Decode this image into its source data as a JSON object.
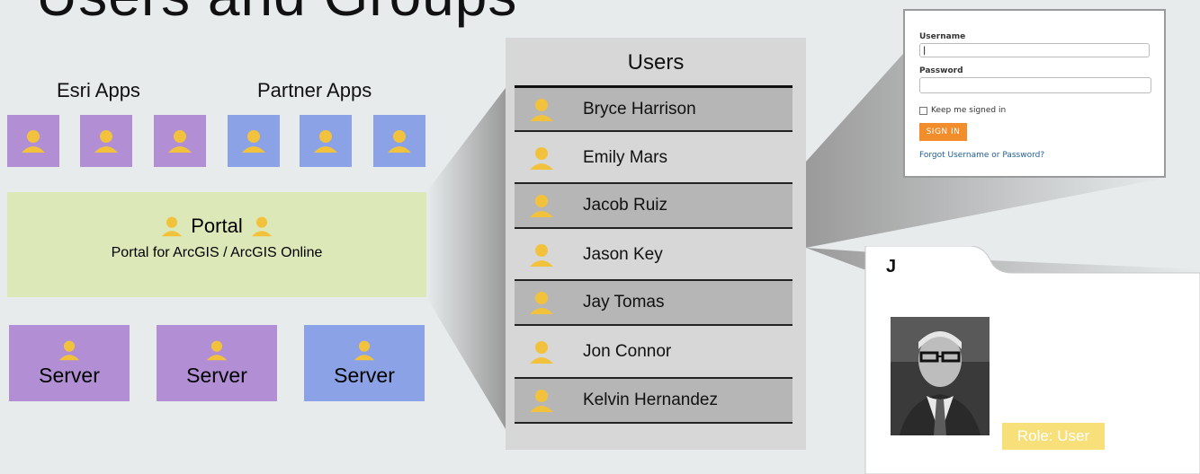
{
  "heading": {
    "text": "Users and Groups"
  },
  "apps": {
    "esri_label": "Esri Apps",
    "partner_label": "Partner Apps",
    "colors": {
      "esri": "#b28fd4",
      "partner": "#8ba3e6"
    }
  },
  "portal": {
    "title": "Portal",
    "subtitle": "Portal for ArcGIS / ArcGIS Online",
    "color": "#dce8b7"
  },
  "servers": [
    {
      "label": "Server",
      "color": "#b28fd4"
    },
    {
      "label": "Server",
      "color": "#b28fd4"
    },
    {
      "label": "Server",
      "color": "#8ba3e6"
    }
  ],
  "users": {
    "title": "Users",
    "list": [
      "Bryce Harrison",
      "Emily Mars",
      "Jacob Ruiz",
      "Jason Key",
      "Jay Tomas",
      "Jon Connor",
      "Kelvin  Hernandez"
    ]
  },
  "login": {
    "username_label": "Username",
    "username_value": "|",
    "password_label": "Password",
    "keep_signed_in": "Keep me signed in",
    "sign_in": "SIGN IN",
    "forgot": "Forgot Username or Password?",
    "accent": "#f28d2b"
  },
  "profile": {
    "letter": "J",
    "role": "Role: User",
    "role_color": "#f7e07a"
  },
  "icon_color": "#f3c23d"
}
